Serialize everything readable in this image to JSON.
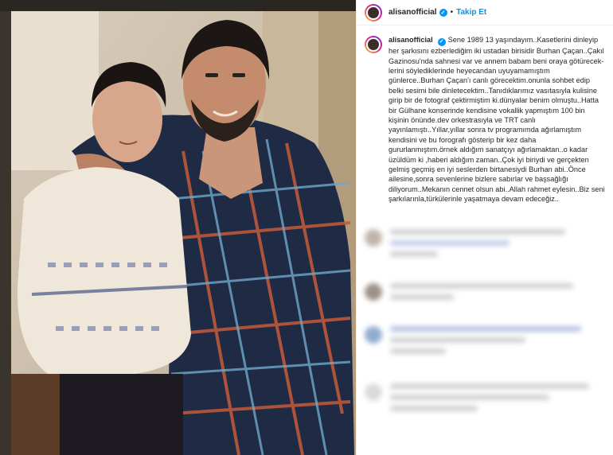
{
  "post": {
    "username": "alisanofficial",
    "follow_label": "Takip Et",
    "separator": "•",
    "verified_mark": "✓",
    "caption": "Sene 1989 13 yaşındayım..Kasetlerini dinleyip her şarkısını ezberlediğim iki ustadan birisidir Burhan Çaçan..Çakıl Gazinosu'nda sahnesi var ve annem babam beni oraya götürecek­lerini söylediklerinde heyecandan uyuyamamıştım günlerce..Burhan Çaçan'ı canlı görecektim.onunla sohbet edip belki sesimi bile dinletecektim..Tanıdıklarımız vasıtasıyla kulisine girip bir de fotograf çektirmiştim ki.dünyalar benim olmuştu..Hatta bir Gülhane konserinde kendisine vokallik yapmıştım 100 bin kişinin önünde.dev orkestrasıyla ve TRT canlı yayınlamıştı..Yıllar,yıllar sonra tv programımda ağırlamıştım kendisini ve bu forografı gösterip bir kez daha gururlanmıştım.örnek aldığım sanatçıyı ağırlamaktan..o kadar üzüldüm ki ,haberi aldığım zaman..Çok iyi biriydi ve gerçekten gelmiş geçmiş en iyi seslerden birtanesiydi Burhan abi..Önce ailesine,sonra sevenlerine bizlere sabırlar ve başsağlığı diliyorum..Mekanın cennet olsun abi..Allah rahmet eylesin..Biz seni şarkılarınla,türkülerinle yaşatmaya devam edeceğiz.."
  },
  "colors": {
    "accent": "#0095f6",
    "text": "#262626",
    "border": "#efefef"
  },
  "icons": {
    "avatar": "avatar-icon",
    "verified": "verified-badge-icon"
  }
}
